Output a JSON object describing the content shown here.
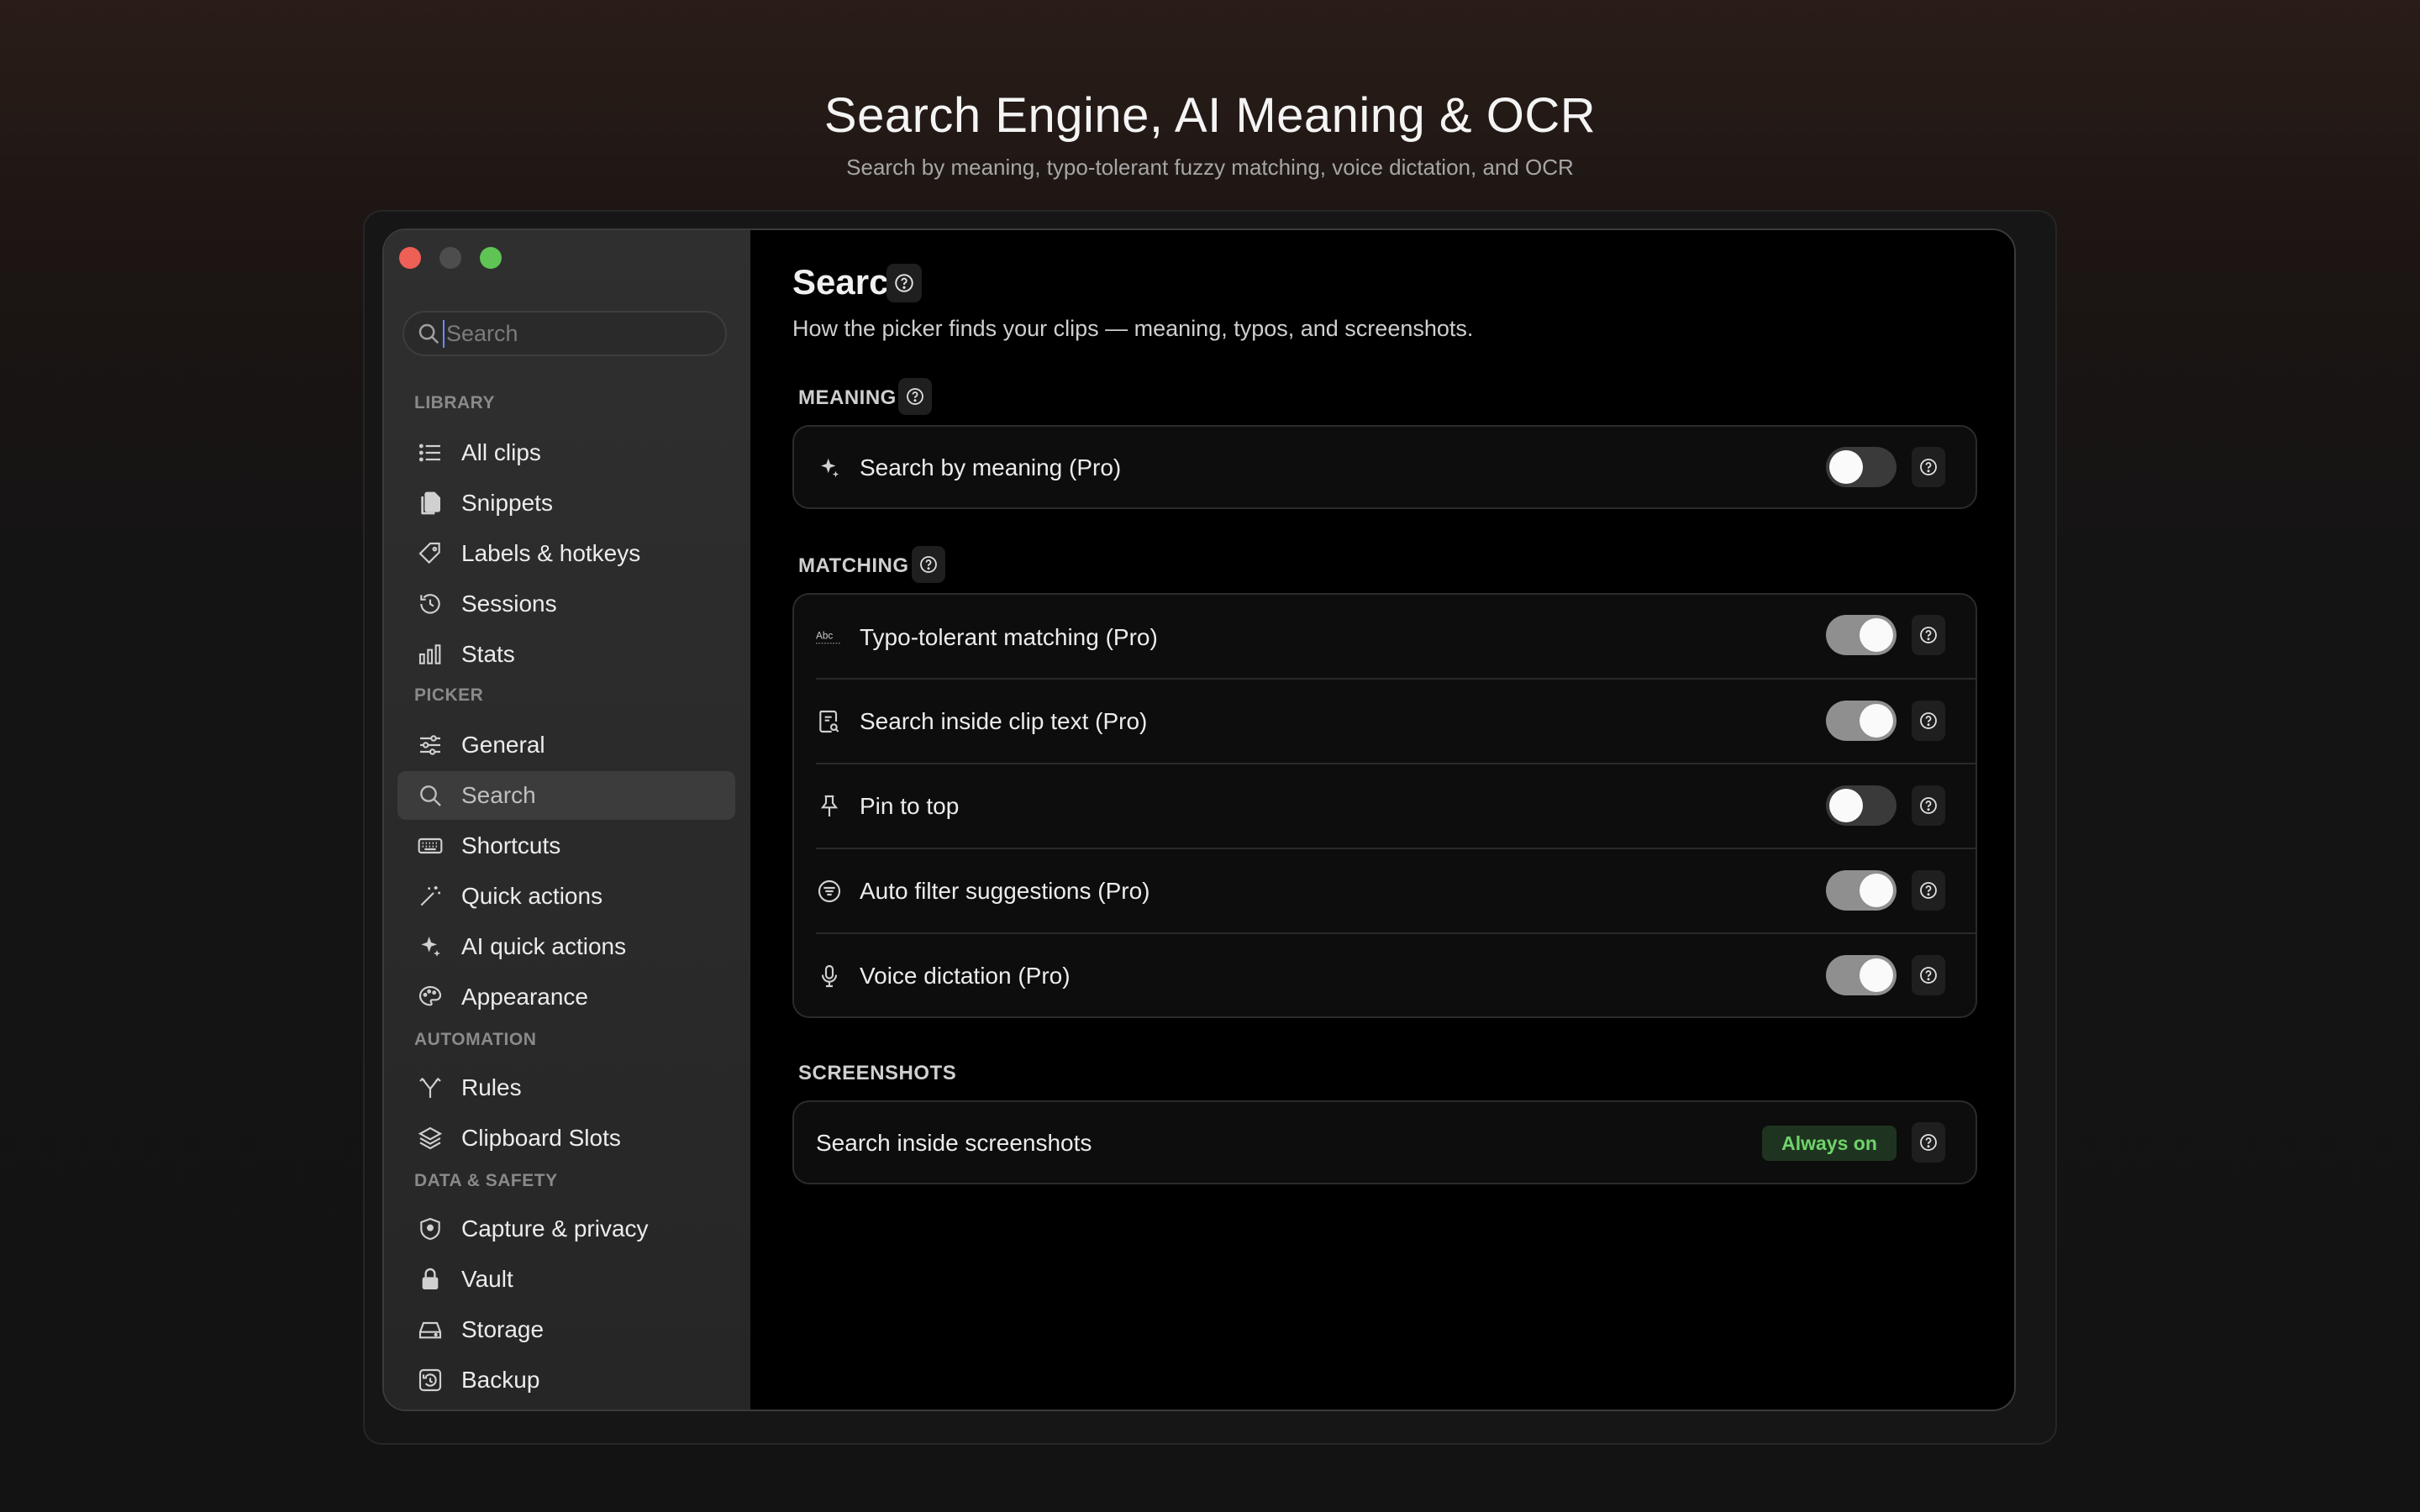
{
  "hero": {
    "title": "Search Engine, AI Meaning & OCR",
    "subtitle": "Search by meaning, typo-tolerant fuzzy matching, voice dictation, and OCR"
  },
  "sidebar": {
    "search_placeholder": "Search",
    "sections": {
      "library": "LIBRARY",
      "picker": "PICKER",
      "automation": "AUTOMATION",
      "data_safety": "DATA & SAFETY"
    },
    "items": {
      "all_clips": "All clips",
      "snippets": "Snippets",
      "labels": "Labels & hotkeys",
      "sessions": "Sessions",
      "stats": "Stats",
      "general": "General",
      "search": "Search",
      "shortcuts": "Shortcuts",
      "quick_actions": "Quick actions",
      "ai_quick_actions": "AI quick actions",
      "appearance": "Appearance",
      "rules": "Rules",
      "clipboard_slots": "Clipboard Slots",
      "capture_privacy": "Capture & privacy",
      "vault": "Vault",
      "storage": "Storage",
      "backup": "Backup"
    },
    "active_item": "Search"
  },
  "main": {
    "title": "Search",
    "subtitle": "How the picker finds your clips — meaning, typos, and screenshots.",
    "groups": {
      "meaning": {
        "label": "MEANING",
        "rows": [
          {
            "label": "Search by meaning (Pro)",
            "icon": "sparkle-icon",
            "enabled": false
          }
        ]
      },
      "matching": {
        "label": "MATCHING",
        "rows": [
          {
            "label": "Typo-tolerant matching (Pro)",
            "icon": "abc-icon",
            "enabled": true
          },
          {
            "label": "Search inside clip text (Pro)",
            "icon": "document-search-icon",
            "enabled": true
          },
          {
            "label": "Pin to top",
            "icon": "pin-icon",
            "enabled": false
          },
          {
            "label": "Auto filter suggestions (Pro)",
            "icon": "filter-icon",
            "enabled": true
          },
          {
            "label": "Voice dictation (Pro)",
            "icon": "microphone-icon",
            "enabled": true
          }
        ]
      },
      "screenshots": {
        "label": "SCREENSHOTS",
        "rows": [
          {
            "label": "Search inside screenshots",
            "badge": "Always on"
          }
        ]
      }
    }
  },
  "colors": {
    "close": "#ee5f56",
    "minimize": "#4d4d4d",
    "zoom": "#5fc453",
    "badge_text": "#6fd46a",
    "toggle_on": "#8f8f8f",
    "toggle_off": "#3a3a3a"
  }
}
